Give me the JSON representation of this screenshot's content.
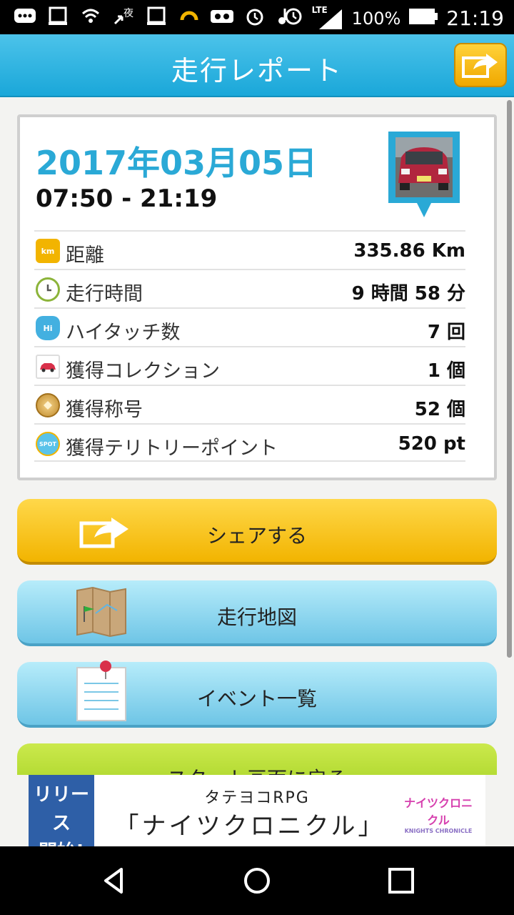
{
  "status_bar": {
    "battery_percent": "100%",
    "clock": "21:19",
    "network": "LTE",
    "icons": [
      "message-icon",
      "news-icon",
      "wifi-calling-icon",
      "night-mode-icon",
      "news-icon",
      "headset-icon",
      "vr-icon",
      "alarm-icon",
      "music-icon",
      "alarm-icon",
      "signal-icon",
      "battery-icon"
    ]
  },
  "app_bar": {
    "title": "走行レポート",
    "share_icon": "share-icon"
  },
  "report": {
    "date": "2017年03月05日",
    "time_range": "07:50 - 21:19",
    "rows": [
      {
        "icon": "km-icon",
        "icon_text": "km",
        "label": "距離",
        "value": "335.86 Km"
      },
      {
        "icon": "clock-icon",
        "icon_text": "",
        "label": "走行時間",
        "value": "9 時間 58 分"
      },
      {
        "icon": "hand-icon",
        "icon_text": "Hi",
        "label": "ハイタッチ数",
        "value": "7 回"
      },
      {
        "icon": "car-icon",
        "icon_text": "",
        "label": "獲得コレクション",
        "value": "1 個"
      },
      {
        "icon": "medal-icon",
        "icon_text": "",
        "label": "獲得称号",
        "value": "52 個"
      },
      {
        "icon": "spot-icon",
        "icon_text": "SPOT",
        "label": "獲得テリトリーポイント",
        "value": "520 pt"
      }
    ]
  },
  "buttons": {
    "share": "シェアする",
    "map": "走行地図",
    "events": "イベント一覧",
    "start": "スタート画面に戻る"
  },
  "ad": {
    "badge_line1": "リリース",
    "badge_line2": "開始!",
    "subtitle": "タテヨコRPG",
    "title": "「ナイツクロニクル」",
    "logo": "ナイツクロニクル",
    "logo_sub": "KNIGHTS CHRONICLE"
  },
  "colors": {
    "accent_blue": "#2aa9d6",
    "appbar_blue": "#1aa7d9",
    "share_yellow": "#f2b400",
    "light_blue_button": "#6ec5e6",
    "green_button": "#9fce1e"
  }
}
